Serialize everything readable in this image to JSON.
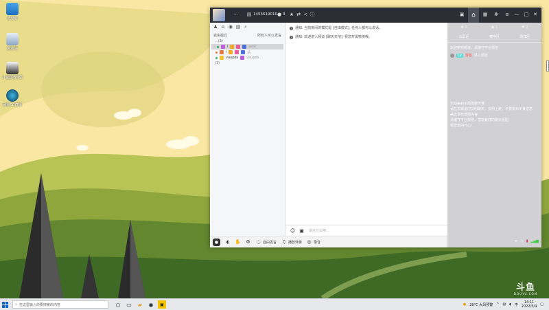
{
  "desktop": {
    "icons": [
      {
        "label": "此电脑"
      },
      {
        "label": "回收站"
      },
      {
        "label": "斗鱼直播伴侣"
      },
      {
        "label": "网易CC直播"
      }
    ]
  },
  "app": {
    "title": {
      "user_id": "1454619010",
      "member_count": "3",
      "dots": "..."
    },
    "left_panel": {
      "mode_label": "自由模式",
      "mode_hint": "所有人可以发言",
      "group_label": "...(3)",
      "members": [
        {
          "name": "i",
          "tail": "jane"
        },
        {
          "name": "i",
          "tail": "头"
        },
        {
          "name": "vaupds",
          "tail": "vaupds"
        }
      ],
      "extra_row": "(1)"
    },
    "chat": {
      "messages": [
        "通知: 当前房间的模式是 [自由模式], 任何人都可以说话。",
        "通知: 欢迎进入频道 [聊天天地], 祝您开黑愉快哦。"
      ]
    },
    "input": {
      "placeholder": "说点什么吧..."
    },
    "bottom_bar": {
      "voice_label": "自由发言",
      "music_label": "播放伴奏",
      "record_label": "录音"
    },
    "right_panel": {
      "stats": [
        "0",
        "1",
        "2"
      ],
      "tabs": [
        "公屏区",
        "麦序区",
        "贵宾区"
      ],
      "welcome": "欢迎来到频道，请遵守平台规范",
      "user_tag": "Lv",
      "user_name": "游客",
      "user_action": "进入频道",
      "rules": [
        "欢迎来到本频道聊天哦",
        "请在本频道内文明聊天，文明上麦，不要发布不良信息",
        "禁止发布低俗内容",
        "请遵守平台规则，营造良好的聊天氛围",
        "祝您玩的开心!"
      ]
    }
  },
  "watermark": {
    "logo_text": "斗鱼",
    "sub": "DOUYU.COM"
  },
  "taskbar": {
    "search_placeholder": "在这里输入你要搜索的内容",
    "weather": "28°C 大风预警",
    "time": "14:11",
    "date": "2022/5/4"
  }
}
